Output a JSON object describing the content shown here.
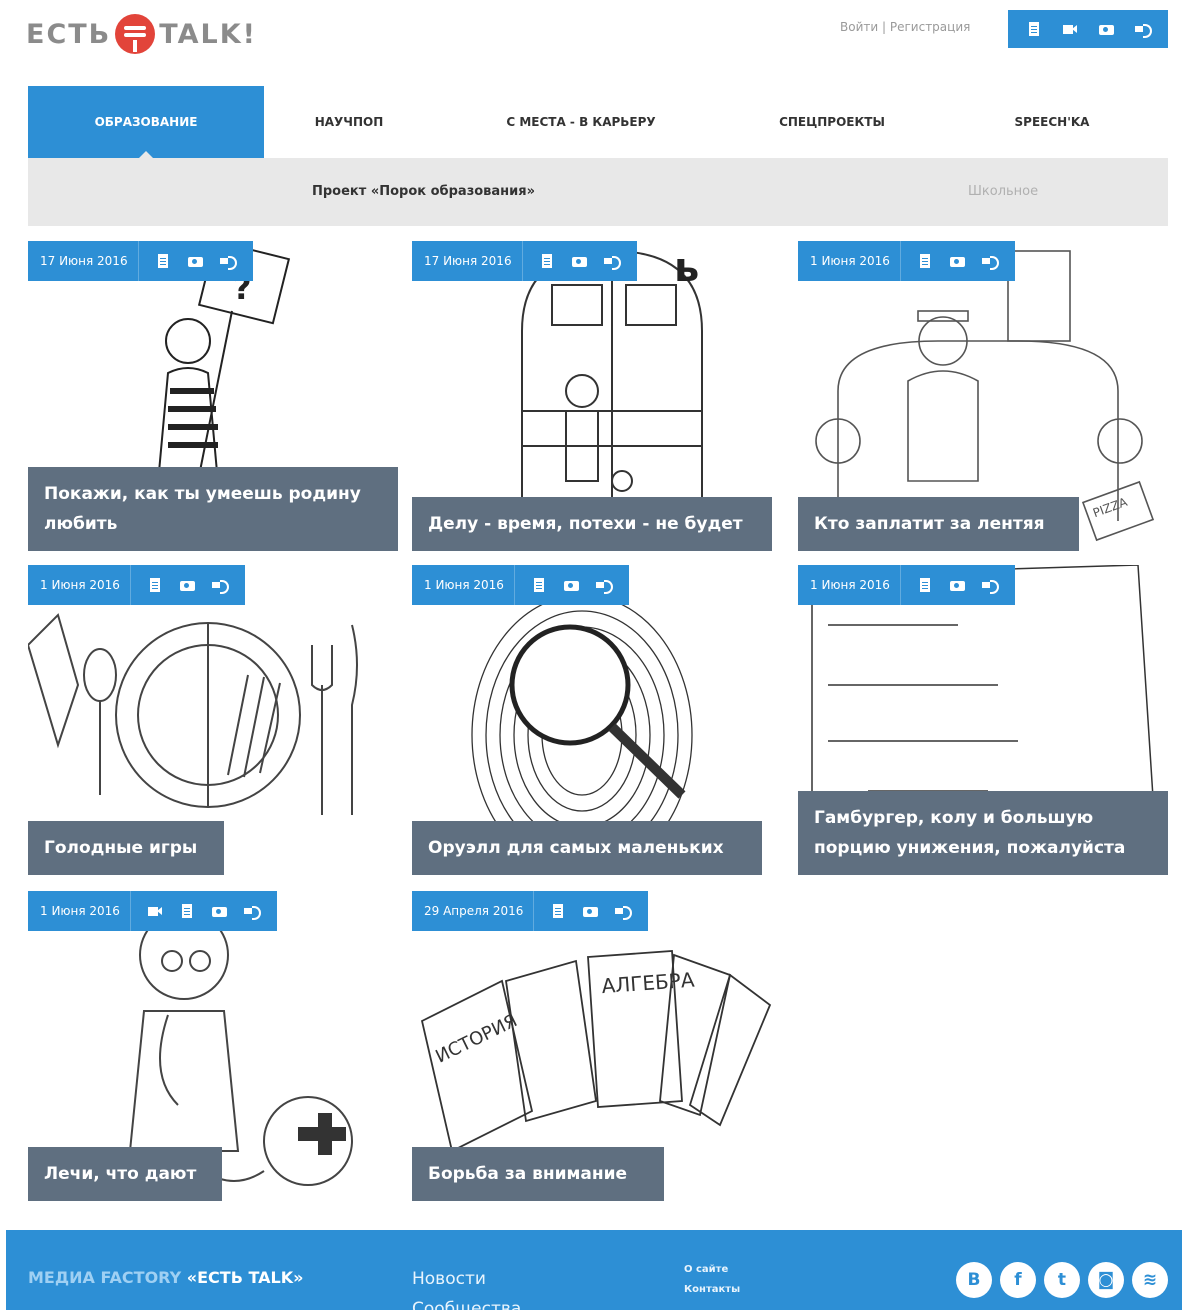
{
  "header": {
    "logo": {
      "left": "ЕСТЬ",
      "right": "TALK!"
    },
    "auth": {
      "login": "Войти",
      "separator": "|",
      "register": "Регистрация"
    },
    "media_icons": [
      "doc-icon",
      "video-icon",
      "photo-icon",
      "audio-icon"
    ]
  },
  "nav": {
    "items": [
      {
        "label": "ОБРАЗОВАНИЕ",
        "active": true
      },
      {
        "label": "НАУЧПОП",
        "active": false
      },
      {
        "label": "С МЕСТА - В КАРЬЕРУ",
        "active": false
      },
      {
        "label": "СПЕЦПРОЕКТЫ",
        "active": false
      },
      {
        "label": "SPEECH'KA",
        "active": false
      }
    ],
    "sub": {
      "project": "Проект «Порок образования»",
      "school": "Школьное"
    }
  },
  "cards": [
    {
      "date": "17 Июня 2016",
      "title": "Покажи, как ты умеешь родину любить",
      "icons": [
        "doc",
        "photo",
        "audio"
      ]
    },
    {
      "date": "17 Июня 2016",
      "title": "Делу - время, потехи - не будет",
      "icons": [
        "doc",
        "photo",
        "audio"
      ]
    },
    {
      "date": "1 Июня 2016",
      "title": "Кто заплатит за лентяя",
      "icons": [
        "doc",
        "photo",
        "audio"
      ]
    },
    {
      "date": "1 Июня 2016",
      "title": "Голодные игры",
      "icons": [
        "doc",
        "photo",
        "audio"
      ]
    },
    {
      "date": "1 Июня 2016",
      "title": "Оруэлл для самых маленьких",
      "icons": [
        "doc",
        "photo",
        "audio"
      ]
    },
    {
      "date": "1 Июня 2016",
      "title": "Гамбургер, колу и большую порцию унижения, пожалуйста",
      "icons": [
        "doc",
        "photo",
        "audio"
      ]
    },
    {
      "date": "1 Июня 2016",
      "title": "Лечи, что дают",
      "icons": [
        "video",
        "doc",
        "photo",
        "audio"
      ]
    },
    {
      "date": "29 Апреля 2016",
      "title": "Борьба за внимание",
      "icons": [
        "doc",
        "photo",
        "audio"
      ]
    }
  ],
  "footer": {
    "brand_prefix": "МЕДИА FACTORY ",
    "brand_name": "«ЕСТЬ TALK»",
    "nav": [
      "Новости",
      "Сообщества"
    ],
    "links": [
      "О сайте",
      "Контакты"
    ],
    "social": [
      {
        "label": "B",
        "name": "vk-icon"
      },
      {
        "label": "f",
        "name": "facebook-icon"
      },
      {
        "label": "t",
        "name": "twitter-icon"
      },
      {
        "label": "◙",
        "name": "instagram-icon"
      },
      {
        "label": "≋",
        "name": "rss-icon"
      }
    ]
  }
}
